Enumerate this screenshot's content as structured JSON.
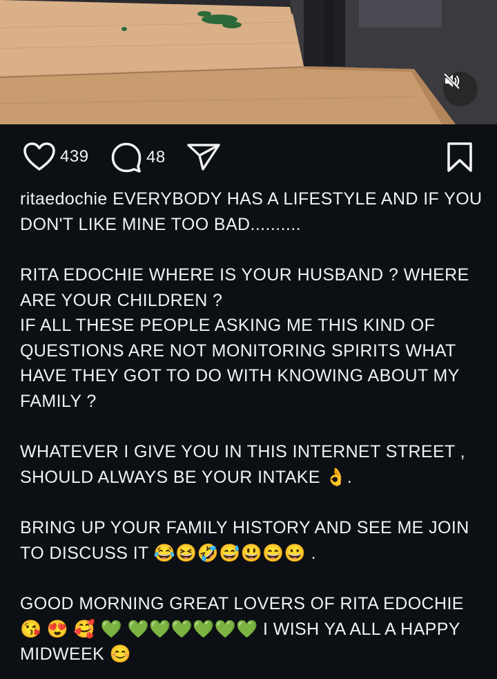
{
  "post": {
    "media": {
      "type": "video",
      "mute_icon": "speaker-muted-icon"
    },
    "actions": {
      "like_icon": "heart-icon",
      "likes": "439",
      "comment_icon": "comment-icon",
      "comments": "48",
      "share_icon": "send-icon",
      "save_icon": "bookmark-icon"
    },
    "caption": {
      "username": "ritaedochie",
      "lines": [
        "EVERYBODY HAS A LIFESTYLE  AND IF YOU DON'T LIKE MINE TOO BAD..........",
        "RITA EDOCHIE WHERE IS YOUR HUSBAND ? WHERE ARE YOUR CHILDREN ?",
        "IF ALL THESE PEOPLE ASKING ME THIS KIND OF QUESTIONS ARE NOT MONITORING SPIRITS WHAT HAVE THEY GOT TO DO WITH KNOWING ABOUT MY FAMILY ?",
        "WHATEVER I GIVE YOU IN THIS INTERNET STREET , SHOULD ALWAYS BE YOUR INTAKE 👌.",
        "BRING UP YOUR FAMILY HISTORY AND SEE ME JOIN TO DISCUSS IT 😂😆🤣😅😃😄😀 .",
        "GOOD MORNING GREAT LOVERS OF RITA EDOCHIE 😘 😍 🥰 💚 💚💚💚💚💚💚 I WISH YA ALL A HAPPY MIDWEEK 😊"
      ]
    }
  }
}
